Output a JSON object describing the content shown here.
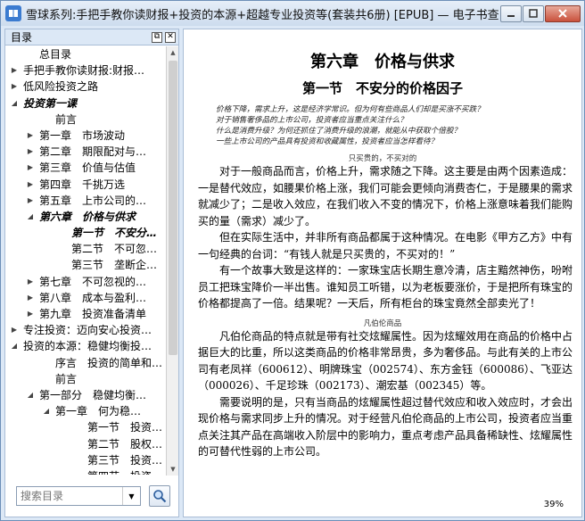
{
  "window": {
    "title": "雪球系列:手把手教你读财报+投资的本源+超越专业投资等(套装共6册) [EPUB] — 电子书查看器"
  },
  "toc": {
    "header": "目录",
    "items": [
      {
        "label": "总目录",
        "indent": 1,
        "toggle": "",
        "bold": false
      },
      {
        "label": "手把手教你读财报:财报…",
        "indent": 0,
        "toggle": "▶",
        "bold": false
      },
      {
        "label": "低风险投资之路",
        "indent": 0,
        "toggle": "▶",
        "bold": false
      },
      {
        "label": "投资第一课",
        "indent": 0,
        "toggle": "◢",
        "bold": true
      },
      {
        "label": "前言",
        "indent": 2,
        "toggle": "",
        "bold": false
      },
      {
        "label": "第一章　市场波动",
        "indent": 1,
        "toggle": "▶",
        "bold": false
      },
      {
        "label": "第二章　期限配对与…",
        "indent": 1,
        "toggle": "▶",
        "bold": false
      },
      {
        "label": "第三章　价值与估值",
        "indent": 1,
        "toggle": "▶",
        "bold": false
      },
      {
        "label": "第四章　千挑万选",
        "indent": 1,
        "toggle": "▶",
        "bold": false
      },
      {
        "label": "第五章　上市公司的…",
        "indent": 1,
        "toggle": "▶",
        "bold": false
      },
      {
        "label": "第六章　价格与供求",
        "indent": 1,
        "toggle": "◢",
        "bold": true
      },
      {
        "label": "第一节　不安分…",
        "indent": 3,
        "toggle": "",
        "bold": true
      },
      {
        "label": "第二节　不可忽…",
        "indent": 3,
        "toggle": "",
        "bold": false
      },
      {
        "label": "第三节　垄断企…",
        "indent": 3,
        "toggle": "",
        "bold": false
      },
      {
        "label": "第七章　不可忽视的…",
        "indent": 1,
        "toggle": "▶",
        "bold": false
      },
      {
        "label": "第八章　成本与盈利…",
        "indent": 1,
        "toggle": "▶",
        "bold": false
      },
      {
        "label": "第九章　投资准备清单",
        "indent": 1,
        "toggle": "▶",
        "bold": false
      },
      {
        "label": "专注投资：迈向安心投资…",
        "indent": 0,
        "toggle": "▶",
        "bold": false
      },
      {
        "label": "投资的本源：稳健均衡投…",
        "indent": 0,
        "toggle": "◢",
        "bold": false
      },
      {
        "label": "序言　投资的简单和…",
        "indent": 2,
        "toggle": "",
        "bold": false
      },
      {
        "label": "前言",
        "indent": 2,
        "toggle": "",
        "bold": false
      },
      {
        "label": "第一部分　稳健均衡…",
        "indent": 1,
        "toggle": "◢",
        "bold": false
      },
      {
        "label": "第一章　何为稳…",
        "indent": 2,
        "toggle": "◢",
        "bold": false
      },
      {
        "label": "第一节　投资…",
        "indent": 4,
        "toggle": "",
        "bold": false
      },
      {
        "label": "第二节　股权…",
        "indent": 4,
        "toggle": "",
        "bold": false
      },
      {
        "label": "第三节　投资…",
        "indent": 4,
        "toggle": "",
        "bold": false
      },
      {
        "label": "第四节　投资…",
        "indent": 4,
        "toggle": "",
        "bold": false
      }
    ],
    "search_placeholder": "搜索目录"
  },
  "reader": {
    "chapter_title": "第六章　价格与供求",
    "section_title": "第一节　不安分的价格因子",
    "quotes": [
      "价格下降，需求上升，这是经济学常识。但为何有些商品人们却是买涨不买跌？",
      "对于销售奢侈品的上市公司，投资者应当重点关注什么？",
      "什么是消费升级？为何还抓住了消费升级的浪潮，就能从中获取个倍股？",
      "一些上市公司的产品具有投资和收藏属性，投资者应当怎样看待？"
    ],
    "sub1": "只买贵的，不买对的",
    "paragraphs1": [
      "对于一般商品而言，价格上升，需求随之下降。这主要是由两个因素造成：一是替代效应，如腰果价格上涨，我们可能会更倾向消费杏仁，于是腰果的需求就减少了；二是收入效应，在我们收入不变的情况下，价格上涨意味着我们能购买的量（需求）减少了。",
      "但在实际生活中，并非所有商品都属于这种情况。在电影《甲方乙方》中有一句经典的台词：“有钱人就是只买贵的，不买对的！”",
      "有一个故事大致是这样的：一家珠宝店长期生意冷清，店主黯然神伤，吩咐员工把珠宝降价一半出售。谁知员工听错，以为老板要涨价，于是把所有珠宝的价格都提高了一倍。结果呢？一天后，所有柜台的珠宝竟然全部卖光了！"
    ],
    "sub2": "凡伯伦商品",
    "paragraphs2": [
      "凡伯伦商品的特点就是带有社交炫耀属性。因为炫耀效用在商品的价格中占据巨大的比重，所以这类商品的价格非常昂贵，多为奢侈品。与此有关的上市公司有老凤祥（600612）、明牌珠宝（002574）、东方金钰（600086）、飞亚达（000026）、千足珍珠（002173）、潮宏基（002345）等。",
      "需要说明的是，只有当商品的炫耀属性超过替代效应和收入效应时，才会出现价格与需求同步上升的情况。对于经营凡伯伦商品的上市公司，投资者应当重点关注其产品在高端收入阶层中的影响力，重点考虑产品具备稀缺性、炫耀属性的可替代性弱的上市公司。"
    ],
    "progress": "39%"
  },
  "colors": {
    "accent": "#3b7bd0",
    "frame": "#dce8f6"
  }
}
